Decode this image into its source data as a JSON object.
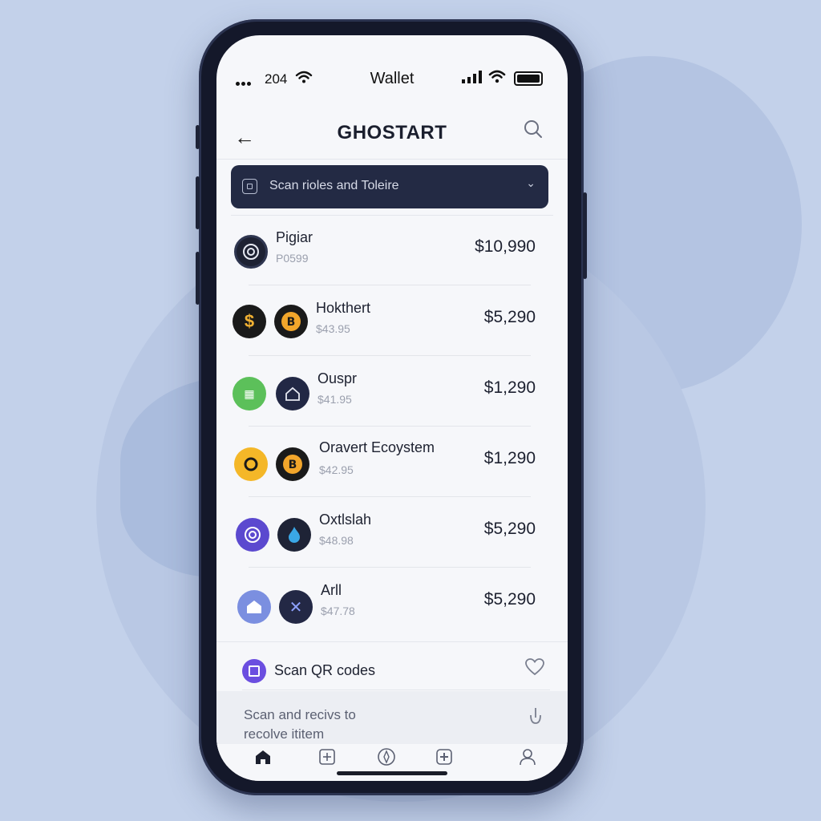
{
  "status": {
    "time": "204",
    "title": "Wallet"
  },
  "header": {
    "title": "GHOSTART"
  },
  "scan_dropdown": {
    "label": "Scan rioles and Toleire"
  },
  "assets": [
    {
      "name": "Pigiar",
      "sub": "P0599",
      "amount": "$10,990"
    },
    {
      "name": "Hokthert",
      "sub": "$43.95",
      "amount": "$5,290"
    },
    {
      "name": "Ouspr",
      "sub": "$41.95",
      "amount": "$1,290"
    },
    {
      "name": "Oravert Ecoystem",
      "sub": "$42.95",
      "amount": "$1,290"
    },
    {
      "name": "Oxtlslah",
      "sub": "$48.98",
      "amount": "$5,290"
    },
    {
      "name": "Arll",
      "sub": "$47.78",
      "amount": "$5,290"
    }
  ],
  "qr": {
    "label": "Scan QR codes"
  },
  "receive": {
    "line1": "Scan and recivs to",
    "line2": "recolve ititem"
  },
  "icons": {
    "back": "arrow-left-icon",
    "search": "search-icon",
    "scan": "scan-icon",
    "chevron": "chevron-down-icon",
    "heart": "heart-icon",
    "download": "download-icon",
    "nav": [
      "home-icon",
      "add-square-icon",
      "compass-icon",
      "plus-square-icon",
      "profile-icon"
    ]
  },
  "colors": {
    "background": "#c3d1ea",
    "accent": "#6b4ee0",
    "dropdown": "#232a44"
  }
}
